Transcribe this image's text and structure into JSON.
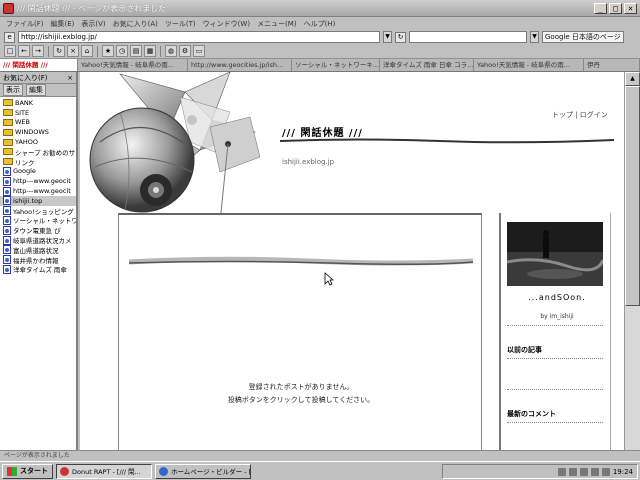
{
  "window": {
    "title": "/// 閑話休題 /// - ページが表示されました",
    "controls": [
      "_",
      "□",
      "×"
    ]
  },
  "menubar": [
    "ファイル(F)",
    "編集(E)",
    "表示(V)",
    "お気に入り(A)",
    "ツール(T)",
    "ウィンドウ(W)",
    "メニュー(M)",
    "ヘルプ(H)"
  ],
  "address": {
    "url": "http://ishijii.exblog.jp/",
    "search_label": "Google 日本語のページ"
  },
  "tabs": [
    {
      "label": "/// 閑話休題 ///",
      "active": true
    },
    {
      "label": "Yahoo!天気情報 - 岐阜県の雨...",
      "active": false
    },
    {
      "label": "http://www.geocities.jp/ish...",
      "active": false
    },
    {
      "label": "ソーシャル・ネットワーキ...",
      "active": false
    },
    {
      "label": "洋傘タイムズ 雨傘 日傘 コラ...",
      "active": false
    },
    {
      "label": "Yahoo!天気情報 - 岐阜県の雨...",
      "active": false
    },
    {
      "label": "伊丹",
      "active": false
    }
  ],
  "sidebar": {
    "title": "お気に入り(F)",
    "close": "×",
    "tools": [
      "表示",
      "編集"
    ],
    "items": [
      {
        "label": "BANK",
        "type": "folder",
        "selected": false
      },
      {
        "label": "SITE",
        "type": "folder",
        "selected": false
      },
      {
        "label": "WEB",
        "type": "folder",
        "selected": false
      },
      {
        "label": "WINDOWS",
        "type": "folder",
        "selected": false
      },
      {
        "label": "YAHOO",
        "type": "folder",
        "selected": false
      },
      {
        "label": "シャープ お勧めのサ",
        "type": "folder",
        "selected": false
      },
      {
        "label": "リンク",
        "type": "folder",
        "selected": false
      },
      {
        "label": "Google",
        "type": "page",
        "selected": false
      },
      {
        "label": "http---www.geocit",
        "type": "page",
        "selected": false
      },
      {
        "label": "http---www.geocit",
        "type": "page",
        "selected": false
      },
      {
        "label": "ishijii.top",
        "type": "page",
        "selected": true
      },
      {
        "label": "Yahoo!ショッピング",
        "type": "page",
        "selected": false
      },
      {
        "label": "ソーシャル・ネットワ",
        "type": "page",
        "selected": false
      },
      {
        "label": "タウン電東急 ぴ",
        "type": "page",
        "selected": false
      },
      {
        "label": "岐阜県道路状況カメ",
        "type": "page",
        "selected": false
      },
      {
        "label": "富山県道路状況",
        "type": "page",
        "selected": false
      },
      {
        "label": "福井県かわ情報",
        "type": "page",
        "selected": false
      },
      {
        "label": "洋傘タイムズ 雨傘",
        "type": "page",
        "selected": false
      }
    ]
  },
  "blog": {
    "nav_links": "トップ | ログイン",
    "title": "/// 閑話休題 ///",
    "url": "ishijii.exblog.jp",
    "empty_line1": "登録されたポストがありません。",
    "empty_line2": "投稿ボタンをクリックして投稿してください。"
  },
  "profile": {
    "name": "...andSOon.",
    "by": "by im_ishiji",
    "recent_posts": "以前の記事",
    "recent_comments": "最新のコメント"
  },
  "statusbar": {
    "text": "ページが表示されました"
  },
  "taskbar": {
    "start": "スタート",
    "tasks": [
      {
        "label": "Donut RAPT - [/// 閑...",
        "pressed": true
      },
      {
        "label": "ホームページ・ビルダー - [...",
        "pressed": false
      }
    ],
    "clock": "19:24"
  }
}
